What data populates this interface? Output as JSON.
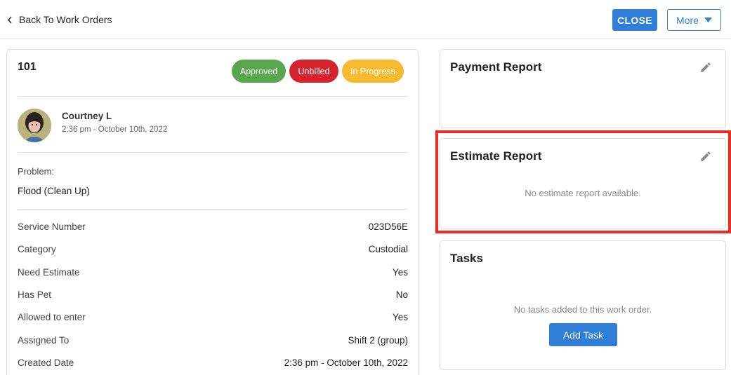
{
  "header": {
    "back_label": "Back To Work Orders",
    "close_label": "CLOSE",
    "more_label": "More"
  },
  "work_order": {
    "number": "101",
    "badges": [
      {
        "label": "Approved",
        "color": "#5aa64f"
      },
      {
        "label": "Unbilled",
        "color": "#d5222d"
      },
      {
        "label": "In Progress",
        "color": "#f6ba30"
      }
    ],
    "user": {
      "name": "Courtney L",
      "time": "2:36 pm - October 10th, 2022"
    },
    "problem_label": "Problem:",
    "problem_value": "Flood (Clean Up)",
    "details": [
      {
        "label": "Service Number",
        "value": "023D56E"
      },
      {
        "label": "Category",
        "value": "Custodial"
      },
      {
        "label": "Need Estimate",
        "value": "Yes"
      },
      {
        "label": "Has Pet",
        "value": "No"
      },
      {
        "label": "Allowed to enter",
        "value": "Yes"
      },
      {
        "label": "Assigned To",
        "value": "Shift 2 (group)"
      },
      {
        "label": "Created Date",
        "value": "2:36 pm - October 10th, 2022"
      }
    ]
  },
  "payment_report": {
    "title": "Payment Report"
  },
  "estimate_report": {
    "title": "Estimate Report",
    "empty_message": "No estimate report available.",
    "highlight_color": "#ee2b22"
  },
  "tasks": {
    "title": "Tasks",
    "empty_message": "No tasks added to this work order.",
    "add_label": "Add Task"
  },
  "colors": {
    "primary": "#2f7fd8"
  }
}
